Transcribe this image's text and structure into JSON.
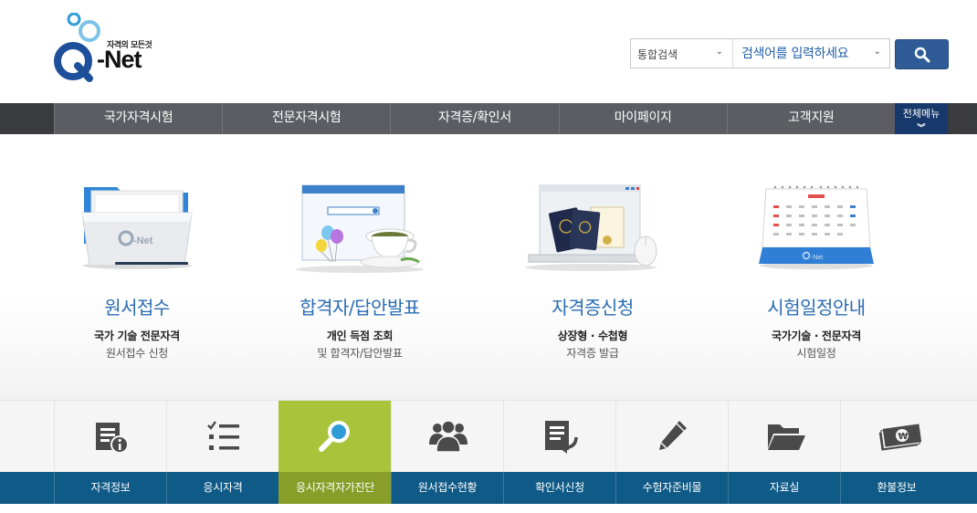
{
  "header": {
    "logo_tagline": "자격의 모든것",
    "logo_word": "-Net",
    "search_scope": "통합검색",
    "search_placeholder": "검색어를 입력하세요",
    "colors": {
      "primary_blue": "#2f5c96",
      "accent_green": "#a9c43a",
      "bar_blue": "#0f5a86"
    }
  },
  "gnb": {
    "items": [
      "국가자격시험",
      "전문자격시험",
      "자격증/확인서",
      "마이페이지",
      "고객지원"
    ],
    "all_menu": "전체메뉴"
  },
  "features": [
    {
      "title": "원서접수",
      "sub1": "국가 기술 전문자격",
      "sub2": "원서접수 신청",
      "icon": "folder-icon"
    },
    {
      "title": "합격자/답안발표",
      "sub1": "개인 득점 조회",
      "sub2": "및 합격자/답안발표",
      "icon": "browser-teacup-icon"
    },
    {
      "title": "자격증신청",
      "sub1": "상장형 · 수첩형",
      "sub2": "자격증 발급",
      "icon": "laptop-certificate-icon"
    },
    {
      "title": "시험일정안내",
      "sub1": "국가기술 · 전문자격",
      "sub2": "시험일정",
      "icon": "calendar-icon"
    }
  ],
  "quick_menu": [
    {
      "label": "자격정보",
      "icon": "info-document-icon",
      "active": false
    },
    {
      "label": "응시자격",
      "icon": "checklist-icon",
      "active": false
    },
    {
      "label": "응시자격자가진단",
      "icon": "magnifier-icon",
      "active": true
    },
    {
      "label": "원서접수현황",
      "icon": "people-icon",
      "active": false
    },
    {
      "label": "확인서신청",
      "icon": "document-return-icon",
      "active": false
    },
    {
      "label": "수험자준비물",
      "icon": "pencil-icon",
      "active": false
    },
    {
      "label": "자료실",
      "icon": "folder-open-icon",
      "active": false
    },
    {
      "label": "환불정보",
      "icon": "money-icon",
      "active": false
    }
  ]
}
